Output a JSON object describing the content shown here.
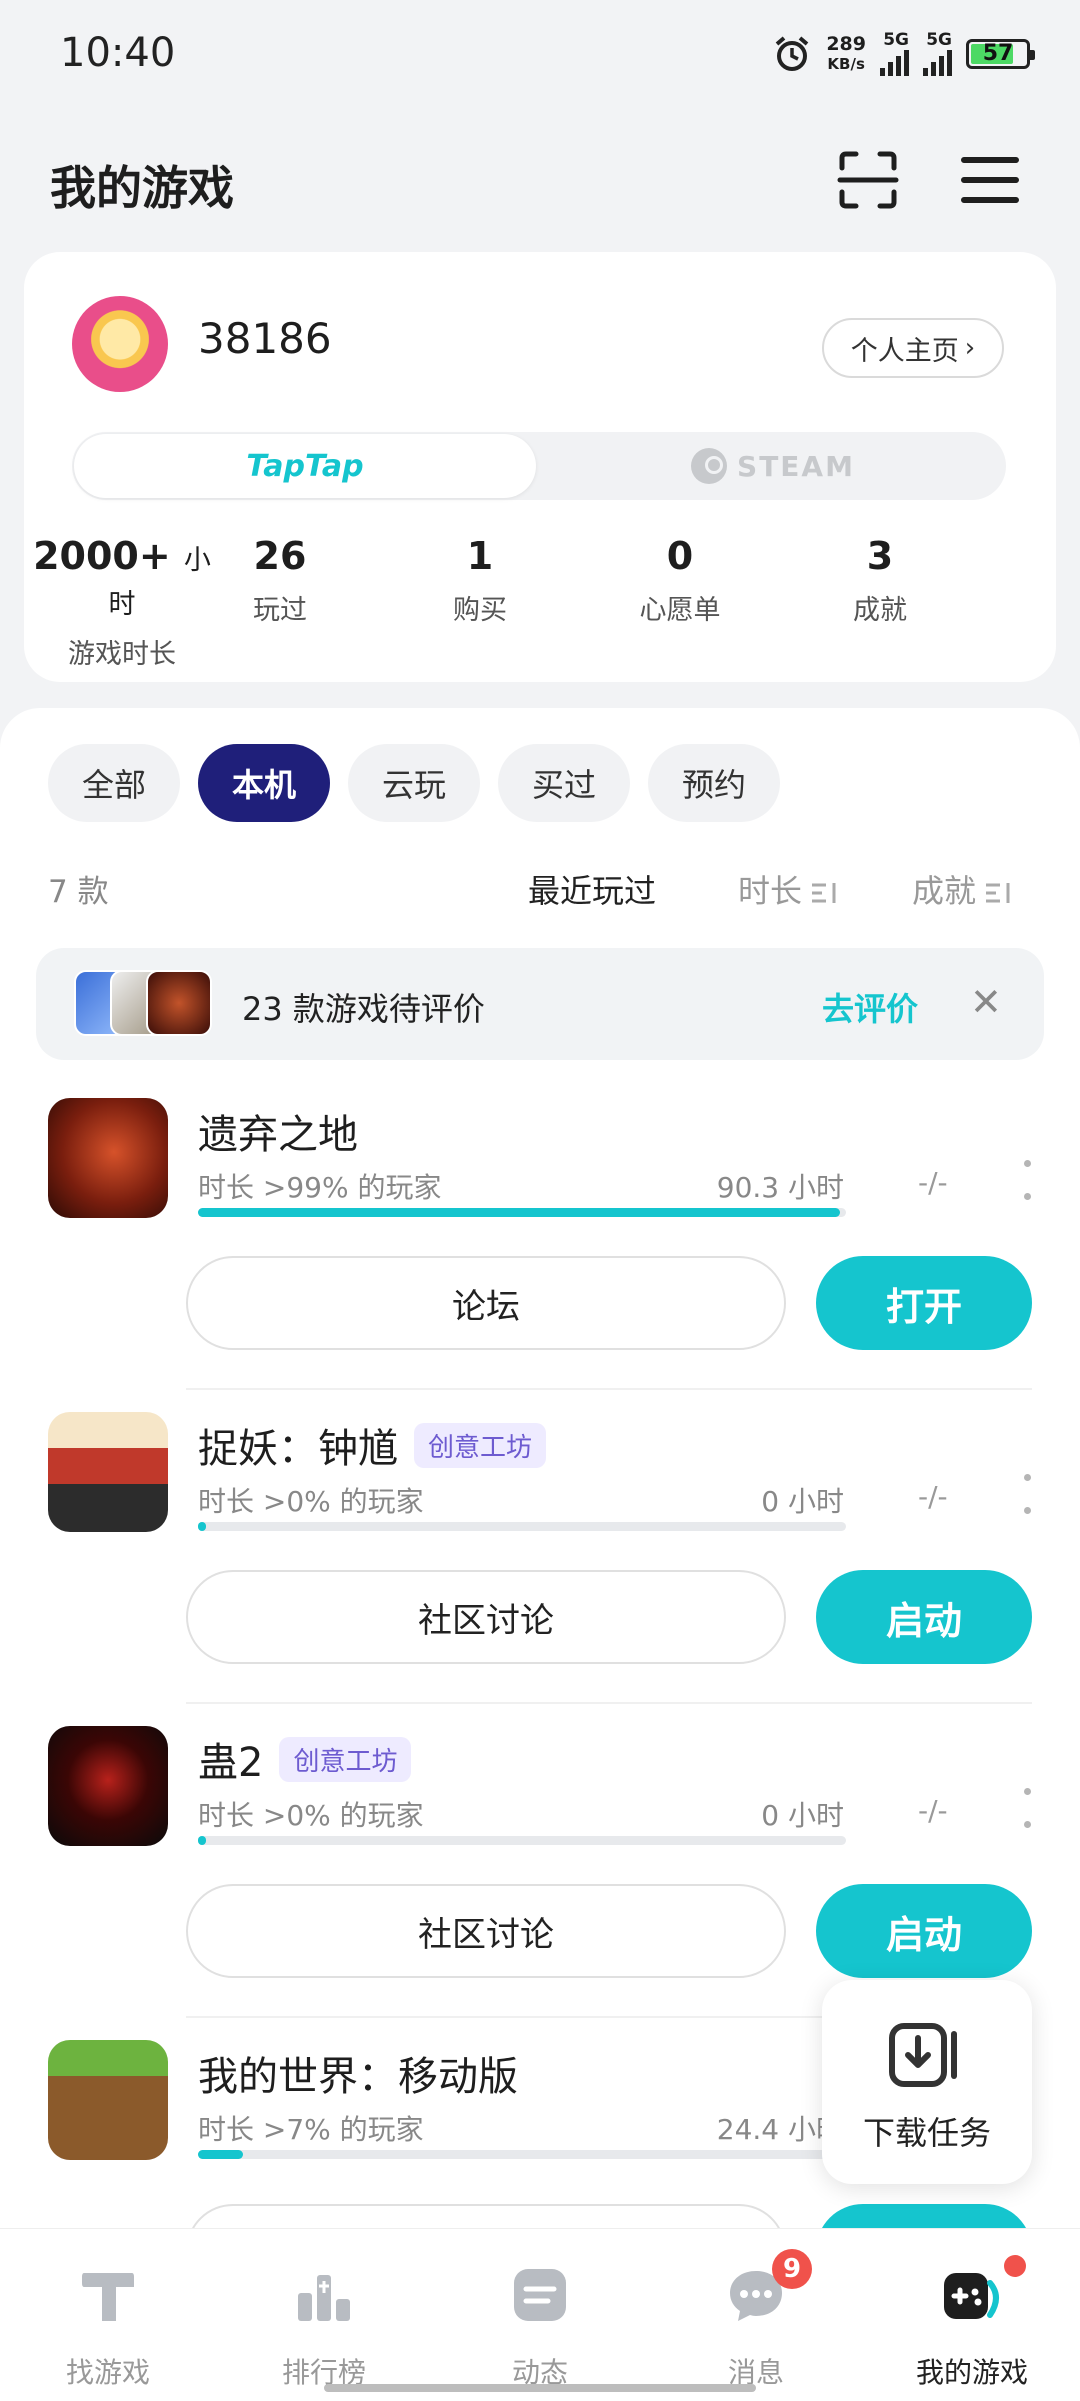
{
  "status_bar": {
    "time": "10:40",
    "speed_value": "289",
    "speed_unit": "KB/s",
    "net1": "5G",
    "net2": "5G",
    "battery": "57"
  },
  "header": {
    "title": "我的游戏",
    "scan_icon": "scan-icon",
    "menu_icon": "menu-icon"
  },
  "profile": {
    "username": "38186",
    "homepage_label": "个人主页",
    "platform_taptap": "TapTap",
    "platform_steam": "STEAM",
    "stats": [
      {
        "value": "2000+",
        "unit": "小时",
        "label": "游戏时长"
      },
      {
        "value": "26",
        "unit": "",
        "label": "玩过"
      },
      {
        "value": "1",
        "unit": "",
        "label": "购买"
      },
      {
        "value": "0",
        "unit": "",
        "label": "心愿单"
      },
      {
        "value": "3",
        "unit": "",
        "label": "成就"
      }
    ]
  },
  "filters": {
    "chips": [
      "全部",
      "本机",
      "云玩",
      "买过",
      "预约"
    ],
    "active": "本机"
  },
  "list_header": {
    "count": "7 款",
    "sort_recent": "最近玩过",
    "sort_duration": "时长",
    "sort_achievement": "成就"
  },
  "review_banner": {
    "text": "23 款游戏待评价",
    "link": "去评价"
  },
  "games": [
    {
      "title": "遗弃之地",
      "tag": "",
      "percentile": "时长 >99% 的玩家",
      "hours": "90.3 小时",
      "progress": 0.99,
      "achievement": "-/-",
      "secondary_btn": "论坛",
      "primary_btn": "打开"
    },
    {
      "title": "捉妖：钟馗",
      "tag": "创意工坊",
      "percentile": "时长 >0% 的玩家",
      "hours": "0 小时",
      "progress": 0.01,
      "achievement": "-/-",
      "secondary_btn": "社区讨论",
      "primary_btn": "启动"
    },
    {
      "title": "蛊2",
      "tag": "创意工坊",
      "percentile": "时长 >0% 的玩家",
      "hours": "0 小时",
      "progress": 0.01,
      "achievement": "-/-",
      "secondary_btn": "社区讨论",
      "primary_btn": "启动"
    },
    {
      "title": "我的世界：移动版",
      "tag": "",
      "percentile": "时长 >7% 的玩家",
      "hours": "24.4 小时",
      "progress": 0.07,
      "achievement": "",
      "secondary_btn": "",
      "primary_btn": ""
    }
  ],
  "download_task": {
    "label": "下载任务"
  },
  "bottom_nav": [
    {
      "label": "找游戏",
      "icon": "find-game-icon"
    },
    {
      "label": "排行榜",
      "icon": "ranking-icon"
    },
    {
      "label": "动态",
      "icon": "feed-icon"
    },
    {
      "label": "消息",
      "icon": "message-icon",
      "badge": "9"
    },
    {
      "label": "我的游戏",
      "icon": "my-games-icon"
    }
  ],
  "colors": {
    "accent": "#15C5CE",
    "chip_active": "#1F1F7A",
    "badge": "#F0524B",
    "tag_text": "#6D5BD0"
  }
}
